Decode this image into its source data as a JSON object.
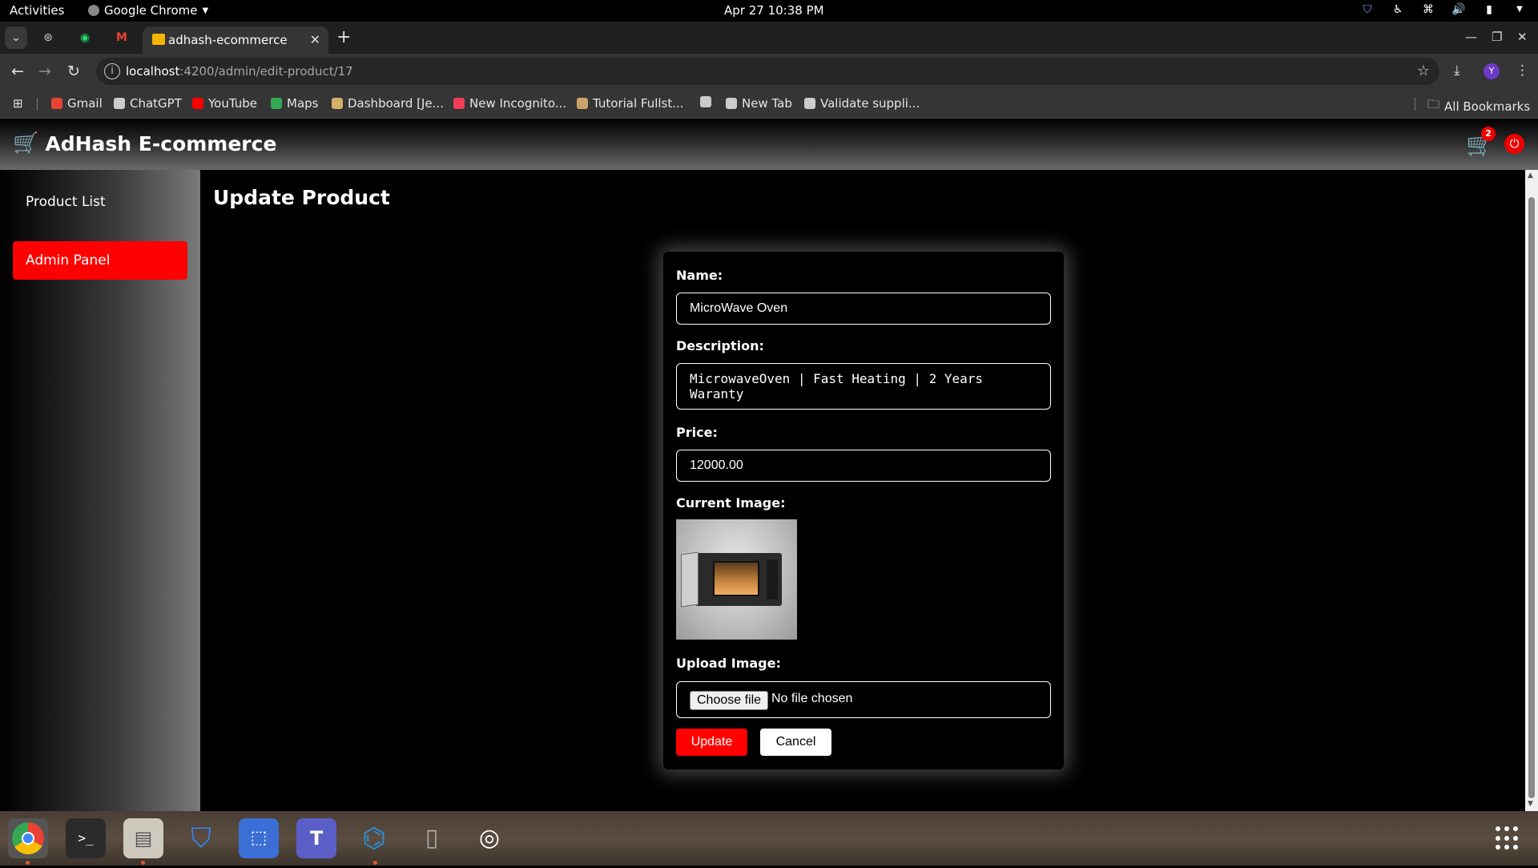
{
  "system_bar": {
    "activities": "Activities",
    "app_name": "Google Chrome",
    "clock": "Apr 27  10:38 PM"
  },
  "browser": {
    "active_tab_title": "adhash-ecommerce",
    "url_host": "localhost",
    "url_path": ":4200/admin/edit-product/17",
    "profile_initial": "Y",
    "bookmarks": [
      {
        "label": "Gmail",
        "icon": "gmail-icon",
        "color": "#ea4335"
      },
      {
        "label": "ChatGPT",
        "icon": "chatgpt-icon",
        "color": "#cccccc"
      },
      {
        "label": "YouTube",
        "icon": "youtube-icon",
        "color": "#ff0000"
      },
      {
        "label": "Maps",
        "icon": "maps-icon",
        "color": "#34a853"
      },
      {
        "label": "Dashboard [Je...",
        "icon": "jenkins-icon",
        "color": "#d6b06b"
      },
      {
        "label": "New Incognito...",
        "icon": "pocket-icon",
        "color": "#ef3f56"
      },
      {
        "label": "Tutorial Fullst...",
        "icon": "tutorial-icon",
        "color": "#c9a36b"
      },
      {
        "label": "",
        "icon": "globe-icon",
        "color": "#cccccc"
      },
      {
        "label": "New Tab",
        "icon": "globe-icon",
        "color": "#cccccc"
      },
      {
        "label": "Validate suppli...",
        "icon": "chatgpt-icon",
        "color": "#cccccc"
      }
    ],
    "all_bookmarks": "All Bookmarks"
  },
  "header": {
    "brand": "AdHash E-commerce",
    "cart_count": "2"
  },
  "sidebar": {
    "items": [
      {
        "label": "Product List",
        "active": false
      },
      {
        "label": "Admin Panel",
        "active": true
      }
    ]
  },
  "main": {
    "title": "Update Product",
    "form": {
      "name_label": "Name:",
      "name_value": "MicroWave Oven",
      "description_label": "Description:",
      "description_value": "MicrowaveOven | Fast Heating | 2 Years\nWaranty",
      "price_label": "Price:",
      "price_value": "12000.00",
      "current_image_label": "Current Image:",
      "upload_image_label": "Upload Image:",
      "choose_file": "Choose file",
      "no_file": "No file chosen",
      "update": "Update",
      "cancel": "Cancel"
    }
  },
  "colors": {
    "accent": "#ff0000",
    "background": "#000000"
  }
}
